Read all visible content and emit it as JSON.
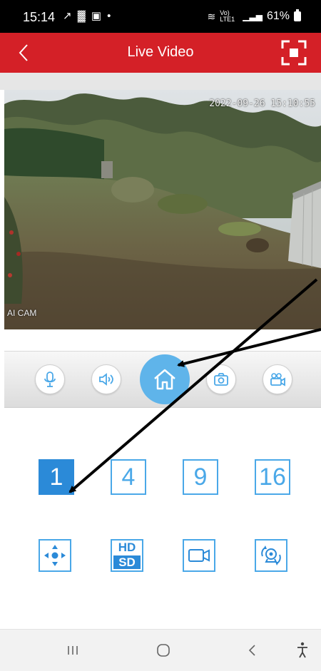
{
  "status": {
    "time": "15:14",
    "icons": "↗ ▓ ▣ •",
    "signal": "Vo) LTE1",
    "battery": "61%"
  },
  "header": {
    "title": "Live Video"
  },
  "video": {
    "timestamp": "2022-09-26 15:10:55",
    "camera_name": "AI CAM"
  },
  "controls": [
    {
      "name": "microphone"
    },
    {
      "name": "speaker"
    },
    {
      "name": "home"
    },
    {
      "name": "snapshot"
    },
    {
      "name": "record"
    }
  ],
  "grid": {
    "options": [
      "1",
      "4",
      "9",
      "16"
    ],
    "selected": "1"
  },
  "functions": {
    "hd_label": "HD",
    "sd_label": "SD"
  },
  "colors": {
    "brand_red": "#d42027",
    "accent_blue": "#4aa8e8",
    "home_blue": "#5fb4ea"
  }
}
